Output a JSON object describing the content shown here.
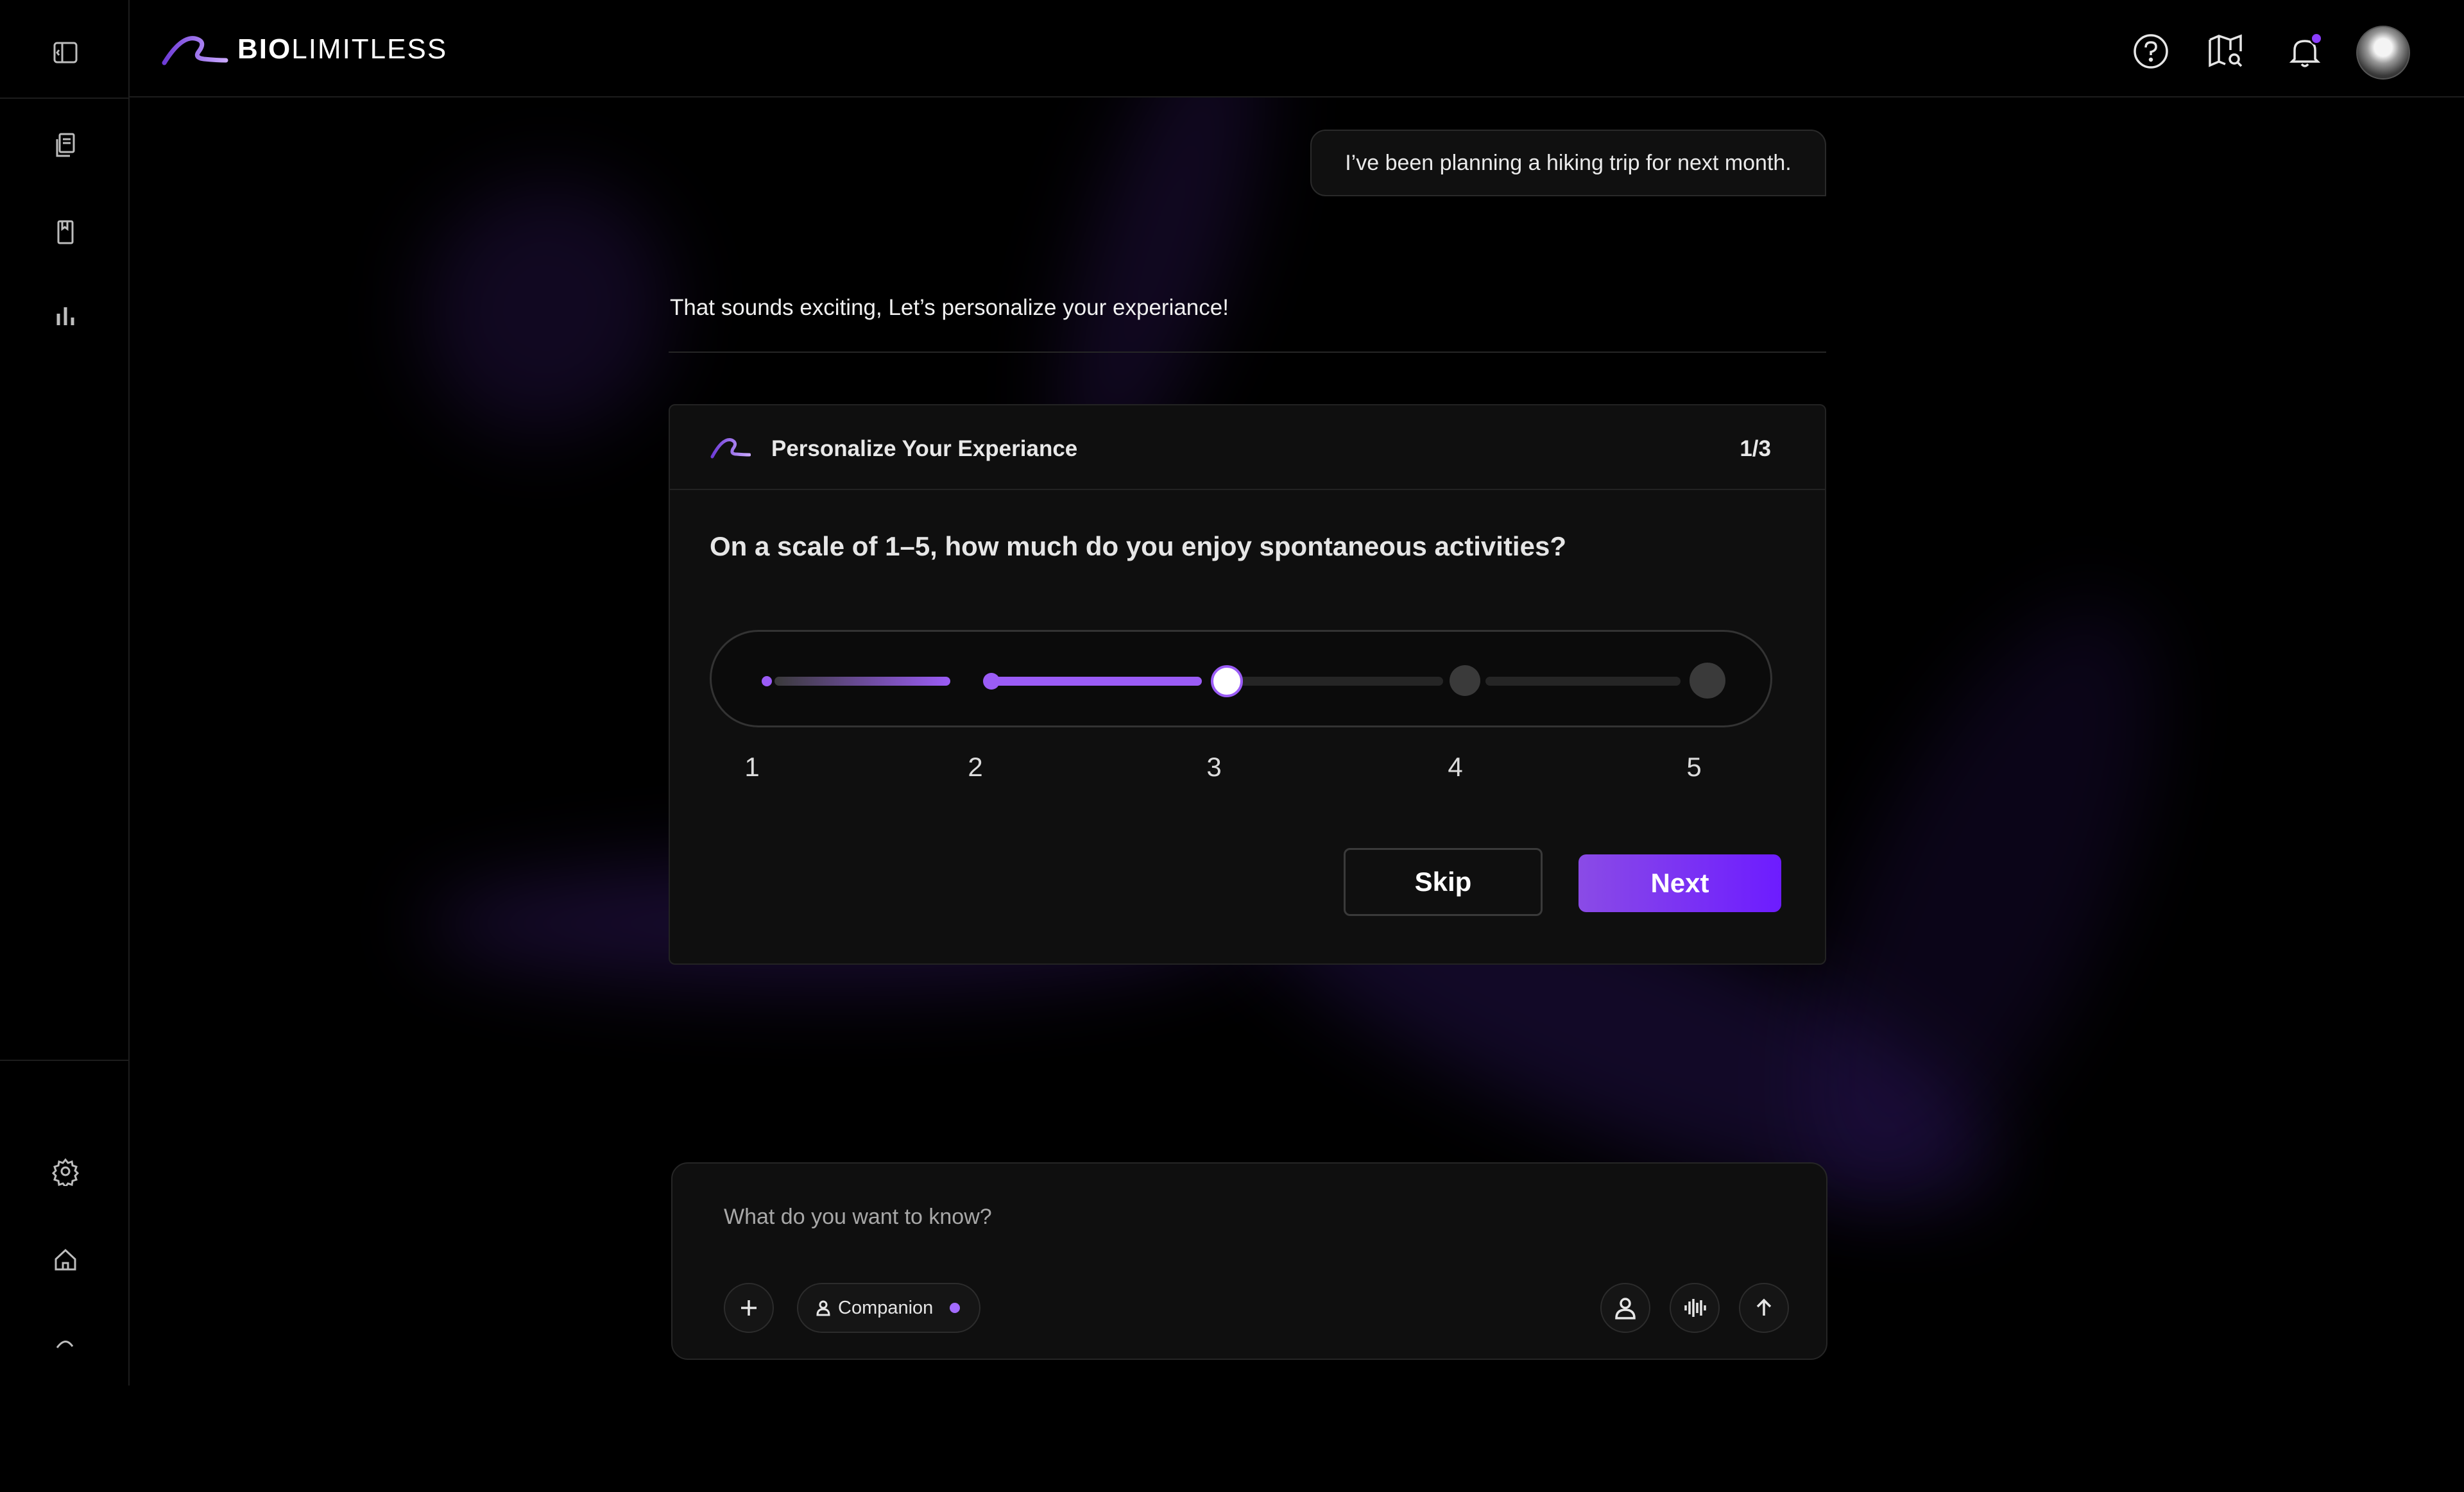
{
  "app": {
    "brand_bold": "BIO",
    "brand_light": "LIMITLESS"
  },
  "header": {
    "help_icon": "help-circle-icon",
    "map_icon": "map-search-icon",
    "bell_icon": "bell-icon",
    "notification_color": "#8b3dff"
  },
  "sidebar": {
    "items": [
      {
        "icon": "sidebar-toggle-icon"
      },
      {
        "icon": "pages-icon"
      },
      {
        "icon": "bookmark-icon"
      },
      {
        "icon": "bar-chart-icon"
      },
      {
        "icon": "settings-gear-icon"
      },
      {
        "icon": "home-icon"
      },
      {
        "icon": "logo-mark-icon"
      }
    ]
  },
  "chat": {
    "user_message": "I’ve been planning a hiking trip for next month.",
    "assistant_message": "That sounds exciting, Let’s personalize your experiance!"
  },
  "survey": {
    "title": "Personalize Your Experiance",
    "progress": "1/3",
    "question": "On a scale of 1–5, how much do you enjoy spontaneous activities?",
    "scale_labels": [
      "1",
      "2",
      "3",
      "4",
      "5"
    ],
    "selected_value": 3,
    "skip_label": "Skip",
    "next_label": "Next",
    "accent_color": "#9b5cf6"
  },
  "composer": {
    "placeholder": "What do you want to know?",
    "mode_label": "Companion"
  }
}
